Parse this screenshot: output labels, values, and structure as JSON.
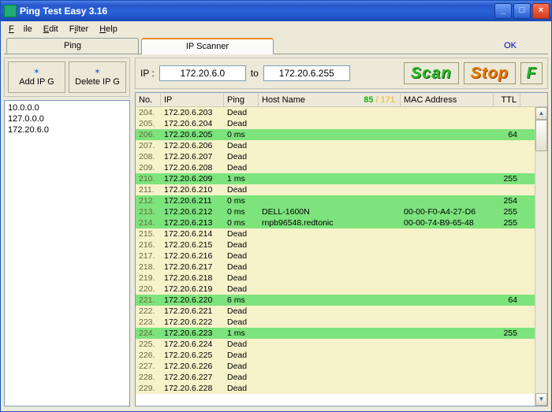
{
  "title": "Ping Test Easy 3.16",
  "menu": {
    "file": "File",
    "edit": "Edit",
    "filter": "Filter",
    "help": "Help"
  },
  "tabs": {
    "ping": "Ping",
    "scanner": "IP Scanner"
  },
  "ok": "OK",
  "toolbar": {
    "add": "Add IP G",
    "delete": "Delete IP G"
  },
  "ipg_list": [
    "10.0.0.0",
    "127.0.0.0",
    "172.20.6.0"
  ],
  "scan": {
    "label": "IP :",
    "from": "172.20.6.0",
    "to_label": "to",
    "to": "172.20.6.255",
    "scan_btn": "Scan",
    "stop_btn": "Stop",
    "f_btn": "F"
  },
  "columns": {
    "no": "No.",
    "ip": "IP",
    "ping": "Ping",
    "host": "Host Name",
    "mac": "MAC Address",
    "ttl": "TTL"
  },
  "counts": {
    "alive": "85",
    "sep": "/",
    "total": "171"
  },
  "rows": [
    {
      "no": "204.",
      "ip": "172.20.6.203",
      "ping": "Dead",
      "host": "",
      "mac": "",
      "ttl": "",
      "alive": false
    },
    {
      "no": "205.",
      "ip": "172.20.6.204",
      "ping": "Dead",
      "host": "",
      "mac": "",
      "ttl": "",
      "alive": false
    },
    {
      "no": "206.",
      "ip": "172.20.6.205",
      "ping": "0 ms",
      "host": "",
      "mac": "",
      "ttl": "64",
      "alive": true
    },
    {
      "no": "207.",
      "ip": "172.20.6.206",
      "ping": "Dead",
      "host": "",
      "mac": "",
      "ttl": "",
      "alive": false
    },
    {
      "no": "208.",
      "ip": "172.20.6.207",
      "ping": "Dead",
      "host": "",
      "mac": "",
      "ttl": "",
      "alive": false
    },
    {
      "no": "209.",
      "ip": "172.20.6.208",
      "ping": "Dead",
      "host": "",
      "mac": "",
      "ttl": "",
      "alive": false
    },
    {
      "no": "210.",
      "ip": "172.20.6.209",
      "ping": "1 ms",
      "host": "",
      "mac": "",
      "ttl": "255",
      "alive": true
    },
    {
      "no": "211.",
      "ip": "172.20.6.210",
      "ping": "Dead",
      "host": "",
      "mac": "",
      "ttl": "",
      "alive": false
    },
    {
      "no": "212.",
      "ip": "172.20.6.211",
      "ping": "0 ms",
      "host": "",
      "mac": "",
      "ttl": "254",
      "alive": true
    },
    {
      "no": "213.",
      "ip": "172.20.6.212",
      "ping": "0 ms",
      "host": "DELL-1600N",
      "mac": "00-00-F0-A4-27-D6",
      "ttl": "255",
      "alive": true
    },
    {
      "no": "214.",
      "ip": "172.20.6.213",
      "ping": "0 ms",
      "host": "rnpb96548.redtonic",
      "mac": "00-00-74-B9-65-48",
      "ttl": "255",
      "alive": true
    },
    {
      "no": "215.",
      "ip": "172.20.6.214",
      "ping": "Dead",
      "host": "",
      "mac": "",
      "ttl": "",
      "alive": false
    },
    {
      "no": "216.",
      "ip": "172.20.6.215",
      "ping": "Dead",
      "host": "",
      "mac": "",
      "ttl": "",
      "alive": false
    },
    {
      "no": "217.",
      "ip": "172.20.6.216",
      "ping": "Dead",
      "host": "",
      "mac": "",
      "ttl": "",
      "alive": false
    },
    {
      "no": "218.",
      "ip": "172.20.6.217",
      "ping": "Dead",
      "host": "",
      "mac": "",
      "ttl": "",
      "alive": false
    },
    {
      "no": "219.",
      "ip": "172.20.6.218",
      "ping": "Dead",
      "host": "",
      "mac": "",
      "ttl": "",
      "alive": false
    },
    {
      "no": "220.",
      "ip": "172.20.6.219",
      "ping": "Dead",
      "host": "",
      "mac": "",
      "ttl": "",
      "alive": false
    },
    {
      "no": "221.",
      "ip": "172.20.6.220",
      "ping": "6 ms",
      "host": "",
      "mac": "",
      "ttl": "64",
      "alive": true
    },
    {
      "no": "222.",
      "ip": "172.20.6.221",
      "ping": "Dead",
      "host": "",
      "mac": "",
      "ttl": "",
      "alive": false
    },
    {
      "no": "223.",
      "ip": "172.20.6.222",
      "ping": "Dead",
      "host": "",
      "mac": "",
      "ttl": "",
      "alive": false
    },
    {
      "no": "224.",
      "ip": "172.20.6.223",
      "ping": "1 ms",
      "host": "",
      "mac": "",
      "ttl": "255",
      "alive": true
    },
    {
      "no": "225.",
      "ip": "172.20.6.224",
      "ping": "Dead",
      "host": "",
      "mac": "",
      "ttl": "",
      "alive": false
    },
    {
      "no": "226.",
      "ip": "172.20.6.225",
      "ping": "Dead",
      "host": "",
      "mac": "",
      "ttl": "",
      "alive": false
    },
    {
      "no": "227.",
      "ip": "172.20.6.226",
      "ping": "Dead",
      "host": "",
      "mac": "",
      "ttl": "",
      "alive": false
    },
    {
      "no": "228.",
      "ip": "172.20.6.227",
      "ping": "Dead",
      "host": "",
      "mac": "",
      "ttl": "",
      "alive": false
    },
    {
      "no": "229.",
      "ip": "172.20.6.228",
      "ping": "Dead",
      "host": "",
      "mac": "",
      "ttl": "",
      "alive": false
    }
  ]
}
